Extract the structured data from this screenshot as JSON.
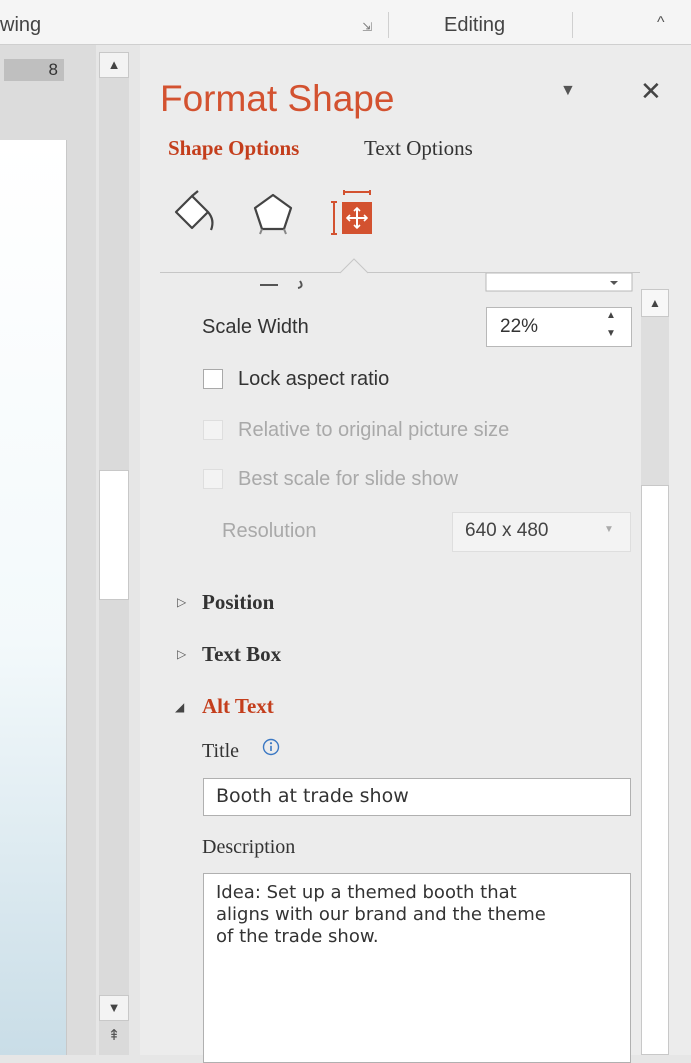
{
  "ribbon": {
    "drawing_label": "wing",
    "editing_label": "Editing",
    "collapse_glyph": "^",
    "launcher_glyph": "⇲"
  },
  "slide": {
    "number": "8"
  },
  "slide_scroll": {
    "up_glyph": "▲",
    "down_glyph": "▼",
    "prev_glyph": "⇞"
  },
  "pane": {
    "title": "Format Shape",
    "menu_glyph": "▼",
    "close_glyph": "✕",
    "tabs": [
      {
        "label": "Shape Options",
        "selected": true
      },
      {
        "label": "Text Options",
        "selected": false
      }
    ],
    "icons": [
      "fill-line-icon",
      "effects-icon",
      "size-properties-icon"
    ],
    "accent_color": "#d35230"
  },
  "size": {
    "scale_width_label": "Scale Width",
    "scale_width_value": "22%",
    "lock_aspect_label": "Lock aspect ratio",
    "lock_aspect_checked": false,
    "relative_label": "Relative to original picture size",
    "best_scale_label": "Best scale for slide show",
    "resolution_label": "Resolution",
    "resolution_value": "640 x 480"
  },
  "sections": {
    "position_label": "Position",
    "textbox_label": "Text Box",
    "alttext_label": "Alt Text",
    "collapsed_glyph": "▷",
    "expanded_glyph": "◢"
  },
  "alt_text": {
    "title_label": "Title",
    "title_value": "Booth at trade show",
    "description_label": "Description",
    "description_value": "Idea: Set up a themed booth that\naligns with our brand and the theme\nof the trade show."
  },
  "pane_scroll": {
    "up_glyph": "▲"
  }
}
